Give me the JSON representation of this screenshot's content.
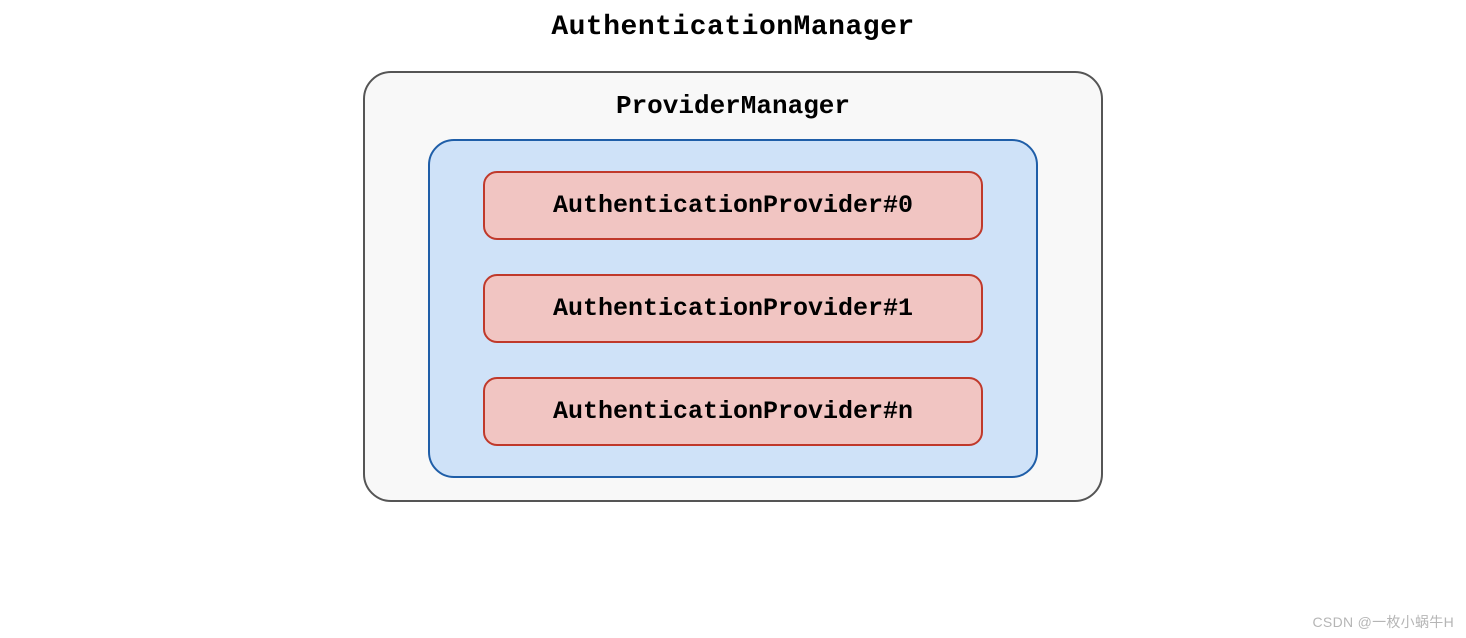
{
  "diagram": {
    "title": "AuthenticationManager",
    "outer": {
      "label": "ProviderManager"
    },
    "providers": [
      {
        "label": "AuthenticationProvider#0"
      },
      {
        "label": "AuthenticationProvider#1"
      },
      {
        "label": "AuthenticationProvider#n"
      }
    ]
  },
  "watermark": "CSDN @一枚小蜗牛H"
}
